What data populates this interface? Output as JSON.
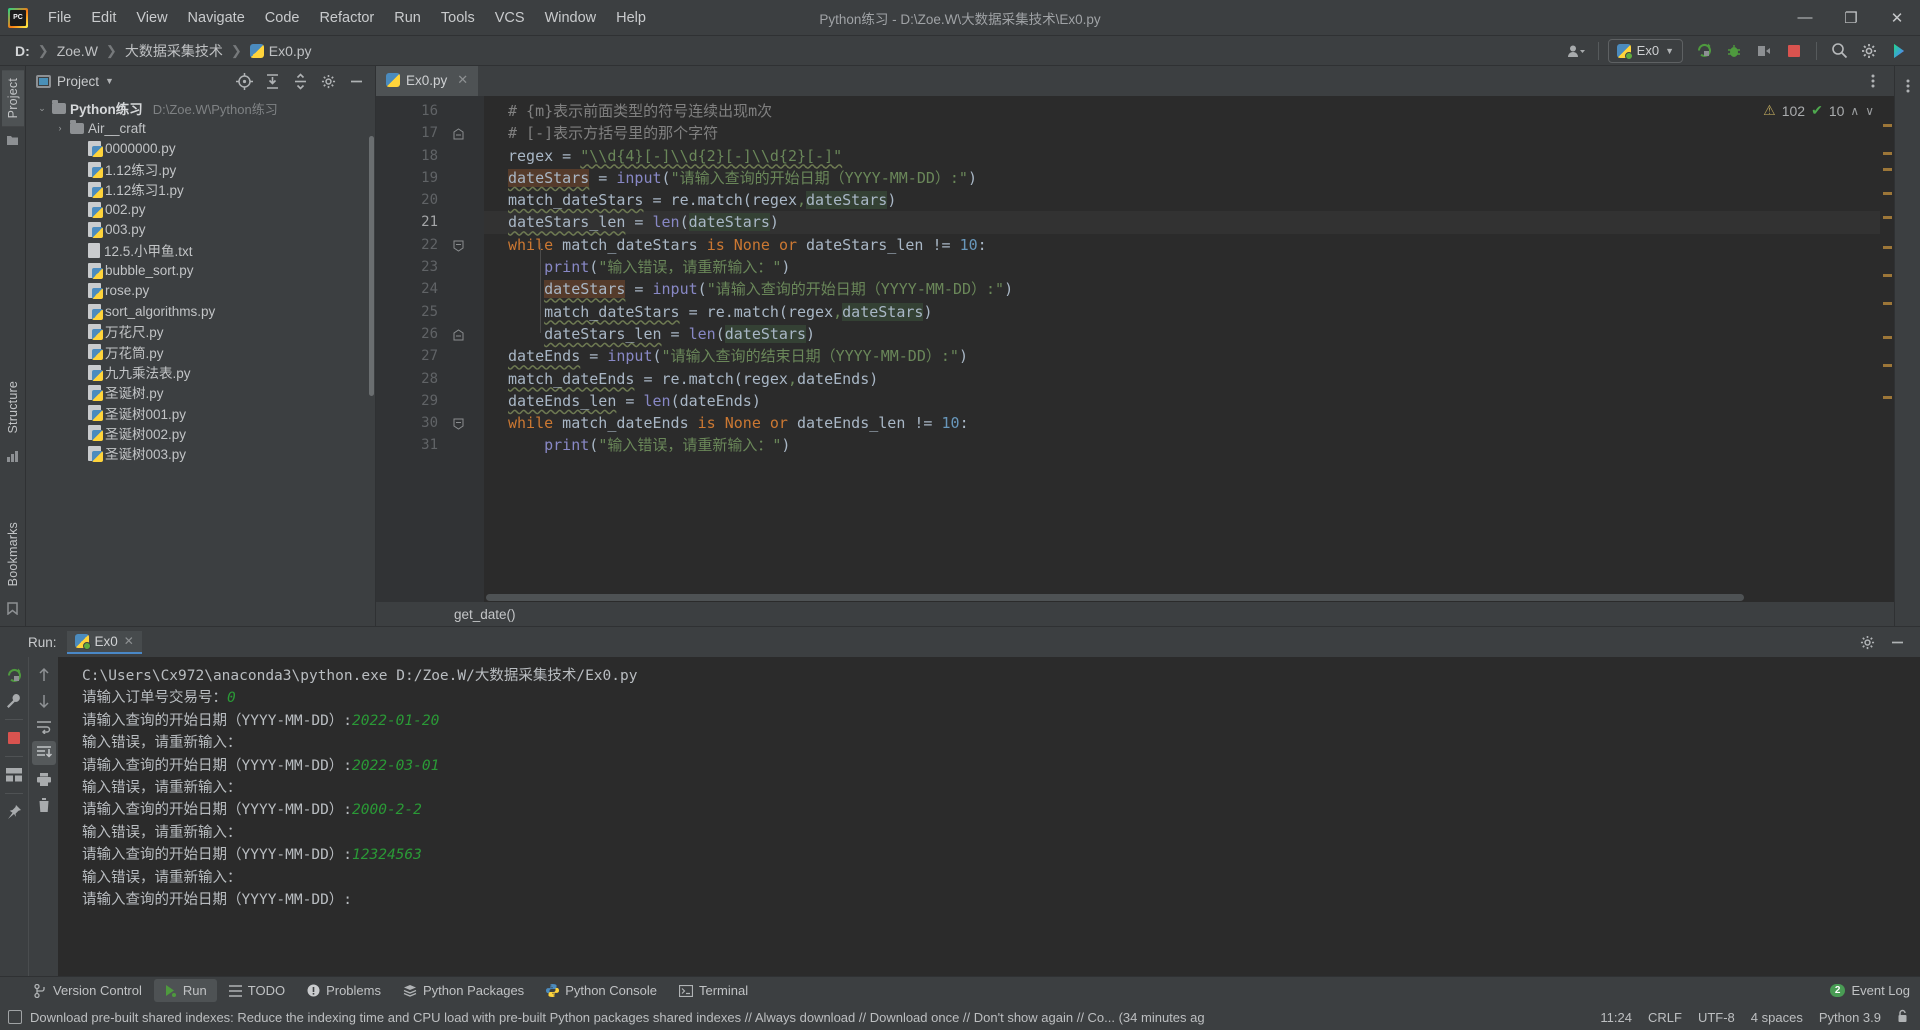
{
  "window": {
    "title": "Python练习 - D:\\Zoe.W\\大数据采集技术\\Ex0.py",
    "minimize": "—",
    "maximize": "❐",
    "close": "✕"
  },
  "menu": {
    "items": [
      "File",
      "Edit",
      "View",
      "Navigate",
      "Code",
      "Refactor",
      "Run",
      "Tools",
      "VCS",
      "Window",
      "Help"
    ]
  },
  "breadcrumb": {
    "items": [
      "D:",
      "Zoe.W",
      "大数据采集技术",
      "Ex0.py"
    ],
    "separator": "❯"
  },
  "toolbar": {
    "run_config_label": "Ex0",
    "icons": [
      "user-avatar-icon",
      "rerun-icon",
      "debug-icon",
      "coverage-icon",
      "stop-icon",
      "search-everywhere-icon",
      "settings-icon",
      "ide-assistant-icon"
    ]
  },
  "project_pane": {
    "title": "Project",
    "scroll_visible": true,
    "tree": [
      {
        "name": "Python练习",
        "path": "D:\\Zoe.W\\Python练习",
        "type": "root",
        "indent": 0,
        "expanded": true,
        "bold": true
      },
      {
        "name": "Air__craft",
        "path": "",
        "type": "folder",
        "indent": 1,
        "expanded": false,
        "bold": false
      },
      {
        "name": "0000000.py",
        "path": "",
        "type": "py",
        "indent": 2,
        "bold": false
      },
      {
        "name": "1.12练习.py",
        "path": "",
        "type": "py",
        "indent": 2,
        "bold": false
      },
      {
        "name": "1.12练习1.py",
        "path": "",
        "type": "py",
        "indent": 2,
        "bold": false
      },
      {
        "name": "002.py",
        "path": "",
        "type": "py",
        "indent": 2,
        "bold": false
      },
      {
        "name": "003.py",
        "path": "",
        "type": "py",
        "indent": 2,
        "bold": false
      },
      {
        "name": "12.5.小甲鱼.txt",
        "path": "",
        "type": "txt",
        "indent": 2,
        "bold": false
      },
      {
        "name": "bubble_sort.py",
        "path": "",
        "type": "py",
        "indent": 2,
        "bold": false
      },
      {
        "name": "rose.py",
        "path": "",
        "type": "py",
        "indent": 2,
        "bold": false
      },
      {
        "name": "sort_algorithms.py",
        "path": "",
        "type": "py",
        "indent": 2,
        "bold": false
      },
      {
        "name": "万花尺.py",
        "path": "",
        "type": "py",
        "indent": 2,
        "bold": false
      },
      {
        "name": "万花筒.py",
        "path": "",
        "type": "py",
        "indent": 2,
        "bold": false
      },
      {
        "name": "九九乘法表.py",
        "path": "",
        "type": "py",
        "indent": 2,
        "bold": false
      },
      {
        "name": "圣诞树.py",
        "path": "",
        "type": "py",
        "indent": 2,
        "bold": false
      },
      {
        "name": "圣诞树001.py",
        "path": "",
        "type": "py",
        "indent": 2,
        "bold": false
      },
      {
        "name": "圣诞树002.py",
        "path": "",
        "type": "py",
        "indent": 2,
        "bold": false
      },
      {
        "name": "圣诞树003.py",
        "path": "",
        "type": "py",
        "indent": 2,
        "bold": false
      }
    ]
  },
  "left_rail": {
    "tabs": [
      "Project"
    ],
    "structure": "Structure",
    "bookmarks": "Bookmarks"
  },
  "editor": {
    "tab_label": "Ex0.py",
    "tab_close": "✕",
    "inspection": {
      "warning_count": "102",
      "ok_count": "10",
      "up": "∧",
      "down": "∨"
    },
    "breadcrumb_function": "get_date()",
    "first_line": 16,
    "current_line": 21,
    "lines": [
      {
        "n": 16,
        "fold": "",
        "html": "<span class=\"cmt\"># {m}表示前面类型的符号连续出现m次</span>",
        "indent": 4
      },
      {
        "n": 17,
        "fold": "end",
        "html": "<span class=\"cmt\"># [-]表示方括号里的那个字符</span>",
        "indent": 4
      },
      {
        "n": 18,
        "fold": "",
        "html": "regex = <span class=\"str var-warn\">\"\\\\d{4}[-]\\\\d{2}[-]\\\\d{2}[-]\"</span>",
        "indent": 4
      },
      {
        "n": 19,
        "fold": "",
        "html": "<span class=\"hl-brown var-warn\">dateStars</span> = <span class=\"fn\">input</span>(<span class=\"str\">\"请输入查询的开始日期（YYYY-MM-DD）:\"</span>)",
        "indent": 4
      },
      {
        "n": 20,
        "fold": "",
        "html": "<span class=\"var-warn\">match_dateStars</span> = re.match(regex<span class=\"str\">,</span><span class=\"hl-green\">dateStars</span>)",
        "indent": 4
      },
      {
        "n": 21,
        "fold": "",
        "html": "<span class=\"var-warn\">dateStars_len</span> = <span class=\"fn\">len</span>(<span class=\"hl-green\">dateStars</span>)",
        "indent": 4
      },
      {
        "n": 22,
        "fold": "start",
        "html": "<span class=\"kw\">while</span> match_dateStars <span class=\"kw\">is</span> <span class=\"kw\">None</span> <span class=\"kw\">or</span> dateStars_len != <span class=\"num2\">10</span>:",
        "indent": 4
      },
      {
        "n": 23,
        "fold": "",
        "html": "    <span class=\"fn\">print</span>(<span class=\"str\">\"输入错误，请重新输入：\"</span>)",
        "indent": 8
      },
      {
        "n": 24,
        "fold": "",
        "html": "    <span class=\"hl-brown var-warn\">dateStars</span> = <span class=\"fn\">input</span>(<span class=\"str\">\"请输入查询的开始日期（YYYY-MM-DD）:\"</span>)",
        "indent": 8
      },
      {
        "n": 25,
        "fold": "",
        "html": "    <span class=\"var-warn\">match_dateStars</span> = re.match(regex<span class=\"str\">,</span><span class=\"hl-green\">dateStars</span>)",
        "indent": 8
      },
      {
        "n": 26,
        "fold": "end",
        "html": "    <span class=\"var-warn\">dateStars_len</span> = <span class=\"fn\">len</span>(<span class=\"hl-green\">dateStars</span>)",
        "indent": 8
      },
      {
        "n": 27,
        "fold": "",
        "html": "<span class=\"var-warn\">dateEnds</span> = <span class=\"fn\">input</span>(<span class=\"str\">\"请输入查询的结束日期（YYYY-MM-DD）:\"</span>)",
        "indent": 4
      },
      {
        "n": 28,
        "fold": "",
        "html": "<span class=\"var-warn\">match_dateEnds</span> = re.match(regex<span class=\"str\">,</span>dateEnds)",
        "indent": 4
      },
      {
        "n": 29,
        "fold": "",
        "html": "<span class=\"var-warn\">dateEnds_len</span> = <span class=\"fn\">len</span>(dateEnds)",
        "indent": 4
      },
      {
        "n": 30,
        "fold": "start",
        "html": "<span class=\"kw\">while</span> match_dateEnds <span class=\"kw\">is</span> <span class=\"kw\">None</span> <span class=\"kw\">or</span> dateEnds_len != <span class=\"num2\">10</span>:",
        "indent": 4
      },
      {
        "n": 31,
        "fold": "",
        "html": "    <span class=\"fn\">print</span>(<span class=\"str\">\"输入错误，请重新输入：\"</span>)",
        "indent": 8
      }
    ]
  },
  "run_panel": {
    "label": "Run:",
    "tab_label": "Ex0",
    "tab_close": "✕",
    "console_lines": [
      {
        "text": "C:\\Users\\Cx972\\anaconda3\\python.exe D:/Zoe.W/大数据采集技术/Ex0.py",
        "input": ""
      },
      {
        "text": "请输入订单号交易号：",
        "input": "0"
      },
      {
        "text": "请输入查询的开始日期（YYYY-MM-DD）:",
        "input": "2022-01-20"
      },
      {
        "text": "输入错误，请重新输入：",
        "input": ""
      },
      {
        "text": "请输入查询的开始日期（YYYY-MM-DD）:",
        "input": "2022-03-01"
      },
      {
        "text": "输入错误，请重新输入：",
        "input": ""
      },
      {
        "text": "请输入查询的开始日期（YYYY-MM-DD）:",
        "input": "2000-2-2"
      },
      {
        "text": "输入错误，请重新输入：",
        "input": ""
      },
      {
        "text": "请输入查询的开始日期（YYYY-MM-DD）:",
        "input": "12324563"
      },
      {
        "text": "输入错误，请重新输入：",
        "input": ""
      },
      {
        "text": "请输入查询的开始日期（YYYY-MM-DD）:",
        "input": ""
      }
    ]
  },
  "bottom_tabs": {
    "items": [
      {
        "label": "Version Control",
        "icon": "branch-icon",
        "active": false
      },
      {
        "label": "Run",
        "icon": "play-icon",
        "active": true
      },
      {
        "label": "TODO",
        "icon": "list-icon",
        "active": false
      },
      {
        "label": "Problems",
        "icon": "error-icon",
        "active": false
      },
      {
        "label": "Python Packages",
        "icon": "packages-icon",
        "active": false
      },
      {
        "label": "Python Console",
        "icon": "python-icon",
        "active": false
      },
      {
        "label": "Terminal",
        "icon": "terminal-icon",
        "active": false
      }
    ],
    "event_log": {
      "label": "Event Log",
      "badge": "2"
    }
  },
  "statusbar": {
    "message": "Download pre-built shared indexes: Reduce the indexing time and CPU load with pre-built Python packages shared indexes // Always download // Download once // Don't show again // Co... (34 minutes ag",
    "time": "11:24",
    "line_sep": "CRLF",
    "encoding": "UTF-8",
    "indent": "4 spaces",
    "interpreter": "Python 3.9",
    "lock_icon": "🔒"
  },
  "colors": {
    "bg": "#3c3f41",
    "editor_bg": "#2b2b2b",
    "accent_blue": "#4a88c7",
    "green": "#499c54",
    "string": "#6a8759",
    "keyword": "#cc7832"
  }
}
